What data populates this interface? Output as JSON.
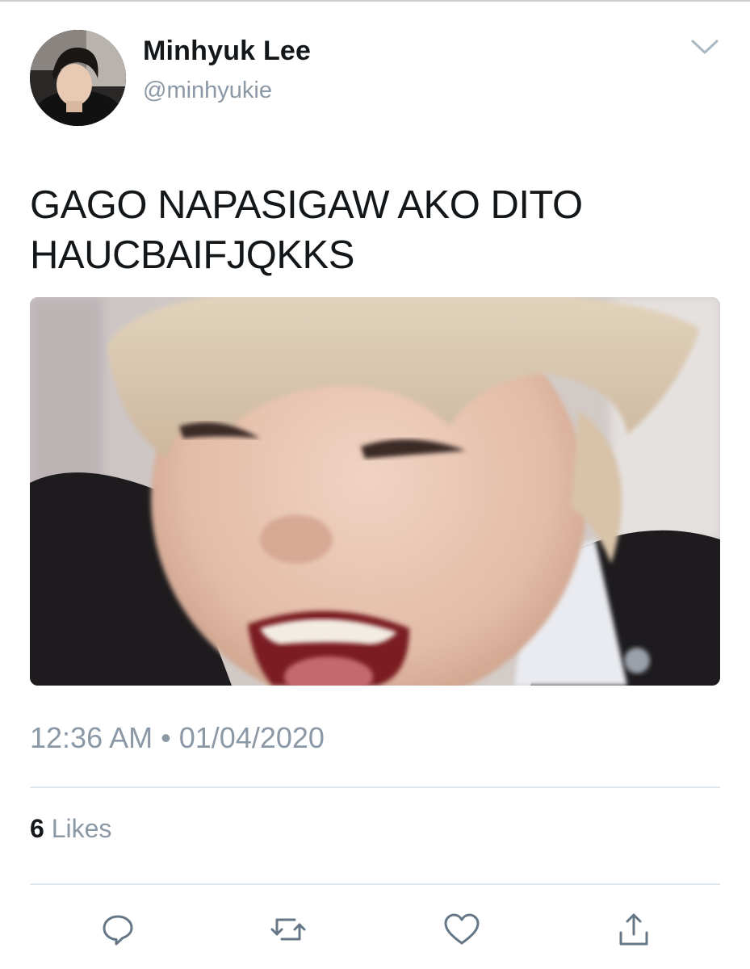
{
  "tweet": {
    "author": {
      "display_name": "Minhyuk Lee",
      "handle": "@minhyukie"
    },
    "text_lines": [
      "GAGO NAPASIGAW AKO DITO",
      "HAUCBAIFJQKKS"
    ],
    "time": "12:36 AM",
    "separator": "•",
    "date": "01/04/2020",
    "likes_count": "6",
    "likes_label": "Likes"
  },
  "actions": {
    "reply_icon": "reply-icon",
    "retweet_icon": "retweet-icon",
    "like_icon": "heart-icon",
    "share_icon": "share-icon"
  },
  "colors": {
    "primary_text": "#14171a",
    "secondary_text": "#8b98a5",
    "divider": "#e1e8ed",
    "icon": "#657786"
  }
}
